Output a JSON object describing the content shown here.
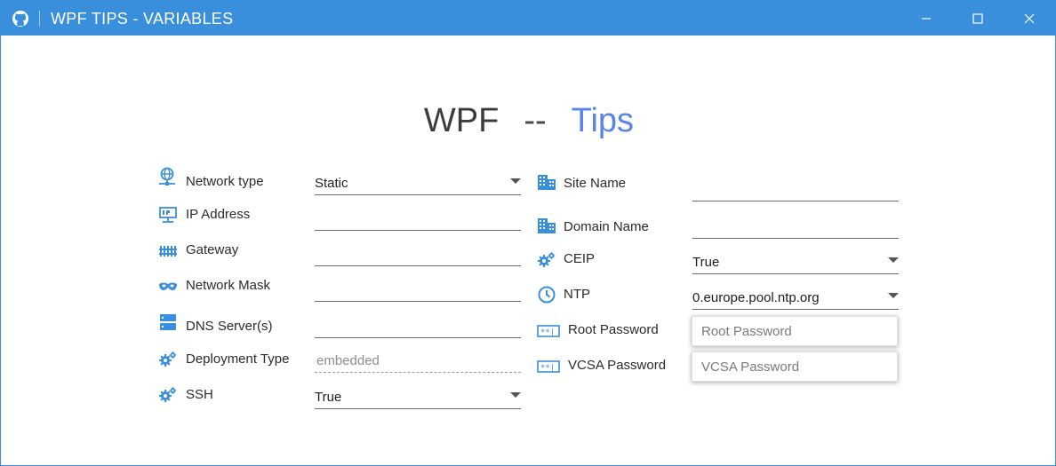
{
  "window": {
    "title": "WPF TIPS - VARIABLES"
  },
  "colors": {
    "titlebar": "#3a8fdc",
    "accent": "#5b84e8",
    "icon": "#3a8fdc"
  },
  "heading": {
    "part1": "WPF",
    "separator": "--",
    "part2": "Tips"
  },
  "left_fields": [
    {
      "label": "Network type",
      "icon": "globe-network-icon",
      "type": "select",
      "value": "Static"
    },
    {
      "label": "IP Address",
      "icon": "ip-monitor-icon",
      "type": "text",
      "value": ""
    },
    {
      "label": "Gateway",
      "icon": "gateway-fence-icon",
      "type": "text",
      "value": ""
    },
    {
      "label": "Network Mask",
      "icon": "mask-icon",
      "type": "text",
      "value": ""
    },
    {
      "label": "DNS Server(s)",
      "icon": "server-icon",
      "type": "text",
      "value": ""
    },
    {
      "label": "Deployment Type",
      "icon": "gears-icon",
      "type": "text-disabled",
      "value": "embedded"
    },
    {
      "label": "SSH",
      "icon": "gears-icon",
      "type": "select",
      "value": "True"
    }
  ],
  "right_fields": [
    {
      "label": "Site Name",
      "icon": "building-icon",
      "type": "text",
      "value": ""
    },
    {
      "label": "Domain Name",
      "icon": "building-icon",
      "type": "text",
      "value": ""
    },
    {
      "label": "CEIP",
      "icon": "gears-icon",
      "type": "select",
      "value": "True"
    },
    {
      "label": "NTP",
      "icon": "clock-icon",
      "type": "select",
      "value": "0.europe.pool.ntp.org"
    },
    {
      "label": "Root Password",
      "icon": "password-icon",
      "type": "password",
      "placeholder": "Root Password"
    },
    {
      "label": "VCSA Password",
      "icon": "password-icon",
      "type": "password",
      "placeholder": "VCSA Password"
    }
  ]
}
